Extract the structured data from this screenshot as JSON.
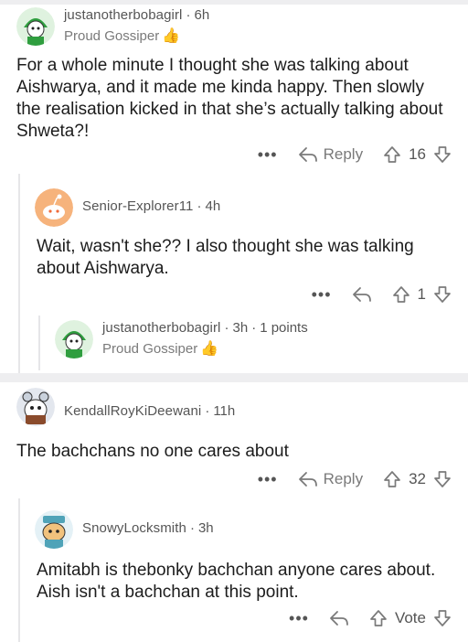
{
  "comments": [
    {
      "username": "justanotherbobagirl",
      "time": "6h",
      "flair": "Proud Gossiper",
      "body": "For a whole minute I thought she was talking about Aishwarya, and it made me kinda happy. Then slowly the realisation kicked in that she’s actually talking about Shweta?!",
      "reply_label": "Reply",
      "score": "16"
    },
    {
      "username": "Senior-Explorer11",
      "time": "4h",
      "body": "Wait, wasn't she?? I also thought she was talking about Aishwarya.",
      "score": "1"
    },
    {
      "username": "justanotherbobagirl",
      "time": "3h",
      "points": "1 points",
      "flair": "Proud Gossiper"
    },
    {
      "username": "KendallRoyKiDeewani",
      "time": "11h",
      "body": "The bachchans no one cares about",
      "reply_label": "Reply",
      "score": "32"
    },
    {
      "username": "SnowyLocksmith",
      "time": "3h",
      "body": "Amitabh is thebonky bachchan anyone cares about. Aish isn't a bachchan at this point.",
      "score": "Vote"
    }
  ],
  "icons": {
    "more": "more-options-icon",
    "reply": "reply-arrow-icon",
    "upvote": "upvote-arrow-icon",
    "downvote": "downvote-arrow-icon",
    "flair": "thumbs-up-icon"
  },
  "colors": {
    "background": "#ffffff",
    "separator": "#eeeef0",
    "muted_text": "#7a7a7a",
    "flair_emoji": "#e8b33a"
  }
}
